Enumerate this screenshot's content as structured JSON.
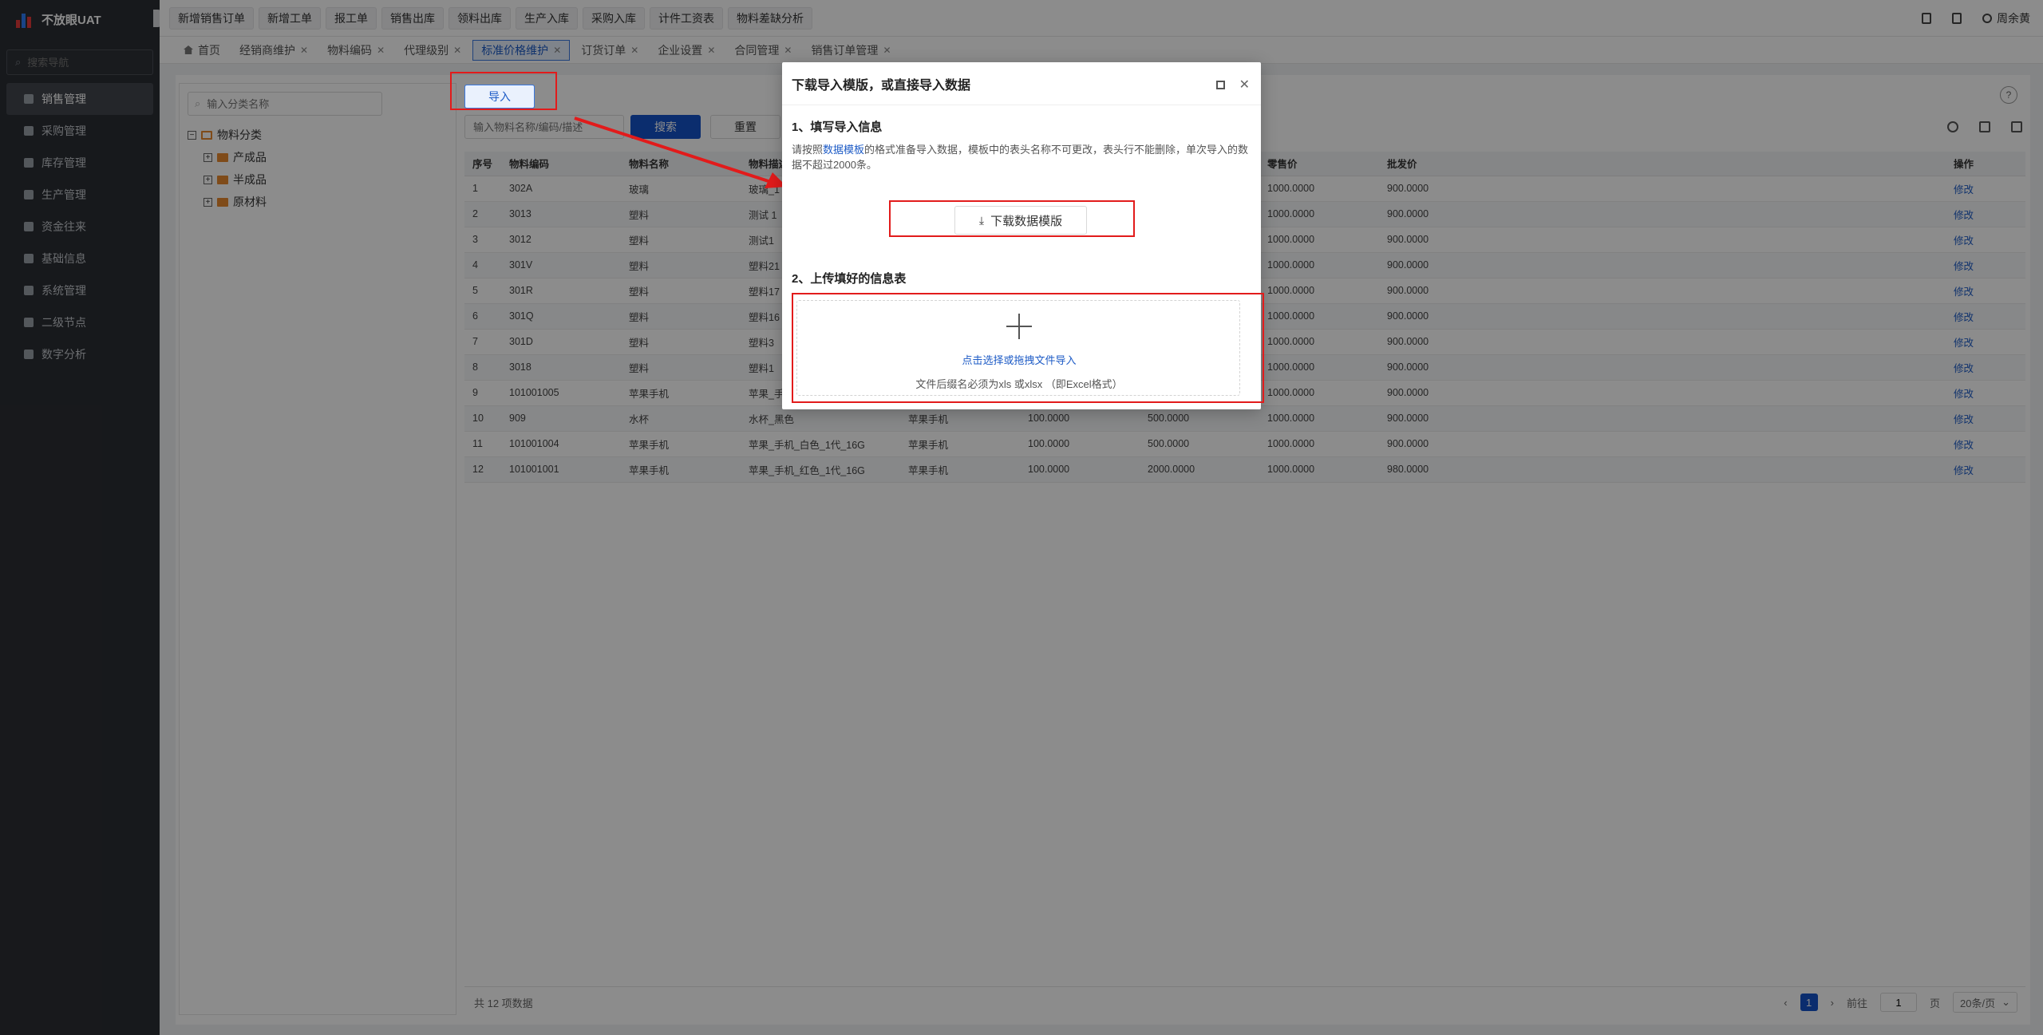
{
  "app": {
    "name": "不放眼UAT"
  },
  "sidebar": {
    "search_placeholder": "搜索导航",
    "items": [
      {
        "label": "销售管理",
        "icon": "tag-icon"
      },
      {
        "label": "采购管理",
        "icon": "cart-icon"
      },
      {
        "label": "库存管理",
        "icon": "box-icon"
      },
      {
        "label": "生产管理",
        "icon": "gear-icon"
      },
      {
        "label": "资金往来",
        "icon": "money-icon"
      },
      {
        "label": "基础信息",
        "icon": "grid-icon"
      },
      {
        "label": "系统管理",
        "icon": "settings-icon"
      },
      {
        "label": "二级节点",
        "icon": "doc-icon"
      },
      {
        "label": "数字分析",
        "icon": "pie-icon"
      }
    ]
  },
  "topbar": {
    "quick": [
      "新增销售订单",
      "新增工单",
      "报工单",
      "销售出库",
      "领料出库",
      "生产入库",
      "采购入库",
      "计件工资表",
      "物料差缺分析"
    ],
    "user": "周余黄"
  },
  "tabs": [
    "首页",
    "经销商维护",
    "物料编码",
    "代理级别",
    "标准价格维护",
    "订货订单",
    "企业设置",
    "合同管理",
    "销售订单管理"
  ],
  "tree": {
    "search_placeholder": "输入分类名称",
    "root": "物料分类",
    "children": [
      "产成品",
      "半成品",
      "原材料"
    ]
  },
  "toolbar": {
    "import": "导入",
    "filter_placeholder": "输入物料名称/编码/描述",
    "search": "搜索",
    "reset": "重置"
  },
  "table": {
    "headers": [
      "序号",
      "物料编码",
      "物料名称",
      "物料描述",
      "",
      "",
      "",
      "零售价",
      "批发价",
      "",
      "操作"
    ],
    "rows": [
      [
        "1",
        "302A",
        "玻璃",
        "玻璃_1",
        "",
        "",
        "",
        "1000.0000",
        "900.0000",
        "",
        "修改"
      ],
      [
        "2",
        "3013",
        "塑料",
        "测试 1",
        "",
        "",
        "",
        "1000.0000",
        "900.0000",
        "",
        "修改"
      ],
      [
        "3",
        "3012",
        "塑料",
        "测试1",
        "",
        "",
        "",
        "1000.0000",
        "900.0000",
        "",
        "修改"
      ],
      [
        "4",
        "301V",
        "塑料",
        "塑料21",
        "",
        "",
        "",
        "1000.0000",
        "900.0000",
        "",
        "修改"
      ],
      [
        "5",
        "301R",
        "塑料",
        "塑料17",
        "",
        "",
        "",
        "1000.0000",
        "900.0000",
        "",
        "修改"
      ],
      [
        "6",
        "301Q",
        "塑料",
        "塑料16",
        "",
        "",
        "",
        "1000.0000",
        "900.0000",
        "",
        "修改"
      ],
      [
        "7",
        "301D",
        "塑料",
        "塑料3",
        "",
        "",
        "",
        "1000.0000",
        "900.0000",
        "",
        "修改"
      ],
      [
        "8",
        "3018",
        "塑料",
        "塑料1",
        "",
        "",
        "",
        "1000.0000",
        "900.0000",
        "",
        "修改"
      ],
      [
        "9",
        "101001005",
        "苹果手机",
        "苹果_手",
        "",
        "",
        "",
        "1000.0000",
        "900.0000",
        "",
        "修改"
      ],
      [
        "10",
        "909",
        "水杯",
        "水杯_黑色",
        "苹果手机",
        "100.0000",
        "500.0000",
        "1000.0000",
        "900.0000",
        "",
        "修改"
      ],
      [
        "11",
        "101001004",
        "苹果手机",
        "苹果_手机_白色_1代_16G",
        "苹果手机",
        "100.0000",
        "500.0000",
        "1000.0000",
        "900.0000",
        "",
        "修改"
      ],
      [
        "12",
        "101001001",
        "苹果手机",
        "苹果_手机_红色_1代_16G",
        "苹果手机",
        "100.0000",
        "2000.0000",
        "1000.0000",
        "980.0000",
        "",
        "修改"
      ]
    ]
  },
  "footer": {
    "total": "共 12 项数据",
    "page": "1",
    "goto_label": "前往",
    "goto_value": "1",
    "goto_unit": "页",
    "page_size": "20条/页"
  },
  "modal": {
    "title": "下载导入模版，或直接导入数据",
    "step1_title": "1、填写导入信息",
    "step1_desc_pre": "请按照",
    "step1_desc_link": "数据模板",
    "step1_desc_post": "的格式准备导入数据，模板中的表头名称不可更改，表头行不能删除，单次导入的数据不超过2000条。",
    "download_btn": "下载数据模版",
    "step2_title": "2、上传填好的信息表",
    "upload_link": "点击选择或拖拽文件导入",
    "upload_hint": "文件后缀名必须为xls 或xlsx （即Excel格式）"
  }
}
